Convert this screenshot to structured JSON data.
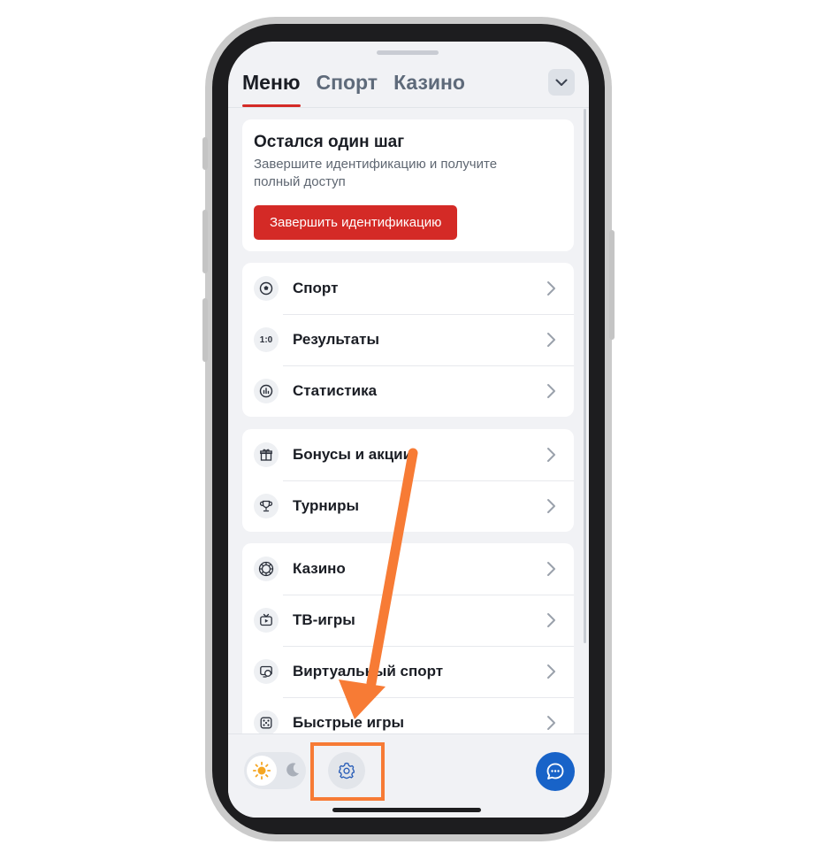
{
  "tabs": [
    {
      "label": "Меню",
      "active": true
    },
    {
      "label": "Спорт",
      "active": false
    },
    {
      "label": "Казино",
      "active": false
    }
  ],
  "promo": {
    "title": "Остался один шаг",
    "text": "Завершите идентификацию и получите полный доступ",
    "button": "Завершить идентификацию"
  },
  "groups": [
    [
      {
        "icon": "soccer-ball-icon",
        "label": "Спорт"
      },
      {
        "icon": "score-icon",
        "icon_text": "1:0",
        "label": "Результаты"
      },
      {
        "icon": "chart-icon",
        "label": "Статистика"
      }
    ],
    [
      {
        "icon": "gift-icon",
        "label": "Бонусы и акции"
      },
      {
        "icon": "trophy-icon",
        "label": "Турниры"
      }
    ],
    [
      {
        "icon": "casino-chip-icon",
        "label": "Казино"
      },
      {
        "icon": "tv-icon",
        "label": "ТВ-игры"
      },
      {
        "icon": "virtual-sport-icon",
        "label": "Виртуальный спорт"
      },
      {
        "icon": "dice-icon",
        "label": "Быстрые игры"
      }
    ]
  ],
  "colors": {
    "accent_red": "#d42a26",
    "chat_blue": "#1863c8",
    "highlight_orange": "#f77b35",
    "sun_orange": "#f5a623"
  }
}
